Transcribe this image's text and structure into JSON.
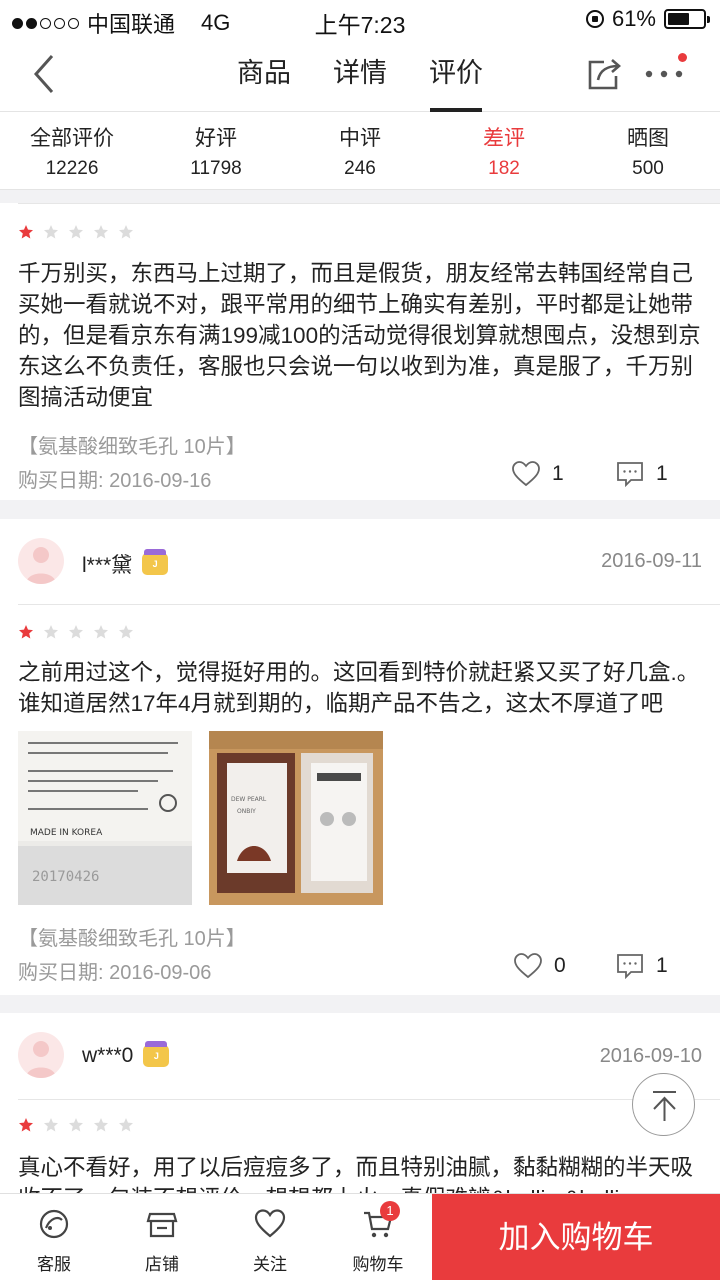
{
  "status_bar": {
    "carrier": "中国联通",
    "network": "4G",
    "time": "上午7:23",
    "battery": "61%",
    "battery_level": 0.61
  },
  "nav": {
    "tabs": [
      {
        "label": "商品",
        "active": false
      },
      {
        "label": "详情",
        "active": false
      },
      {
        "label": "评价",
        "active": true
      }
    ],
    "icons": [
      "back-arrow-icon",
      "share-icon",
      "more-icon"
    ]
  },
  "filters": [
    {
      "label": "全部评价",
      "count": "12226",
      "active": false
    },
    {
      "label": "好评",
      "count": "11798",
      "active": false
    },
    {
      "label": "中评",
      "count": "246",
      "active": false
    },
    {
      "label": "差评",
      "count": "182",
      "active": true
    },
    {
      "label": "晒图",
      "count": "500",
      "active": false
    }
  ],
  "reviews": [
    {
      "rating": 1,
      "text": "千万别买，东西马上过期了，而且是假货，朋友经常去韩国经常自己买她一看就说不对，跟平常用的细节上确实有差别，平时都是让她带的，但是看京东有满199减100的活动觉得很划算就想囤点，没想到京东这么不负责任，客服也只会说一句以收到为准，真是服了，千万别图搞活动便宜",
      "spec": "【氨基酸细致毛孔 10片】",
      "purchase_date": "购买日期: 2016-09-16",
      "likes": "1",
      "comments": "1"
    },
    {
      "user": "l***黛",
      "date": "2016-09-11",
      "rating": 1,
      "text": "之前用过这个，觉得挺好用的。这回看到特价就赶紧又买了好几盒.。谁知道居然17年4月就到期的，临期产品不告之，这太不厚道了吧",
      "spec": "【氨基酸细致毛孔 10片】",
      "purchase_date": "购买日期: 2016-09-06",
      "likes": "0",
      "comments": "1",
      "photos": [
        {
          "lines": [
            "MADE IN KOREA",
            "20170426"
          ]
        },
        {
          "lines": [
            "DEW PEARL",
            "ONBIY"
          ]
        }
      ]
    },
    {
      "user": "w***0",
      "date": "2016-09-10",
      "rating": 1,
      "text": "真心不看好，用了以后痘痘多了，而且特别油腻，黏黏糊糊的半天吸收不了，包装不想评价，想想都上火，真假难辨&hellip;&hellip;"
    }
  ],
  "bottom_bar": {
    "items": [
      {
        "label": "客服",
        "icon": "customer-service-icon"
      },
      {
        "label": "店铺",
        "icon": "store-icon"
      },
      {
        "label": "关注",
        "icon": "heart-icon"
      },
      {
        "label": "购物车",
        "icon": "cart-icon",
        "badge": "1"
      }
    ],
    "add_to_cart": "加入购物车"
  },
  "colors": {
    "accent": "#e93b3d",
    "muted": "#9a9a9a",
    "background": "#f2f2f4"
  }
}
